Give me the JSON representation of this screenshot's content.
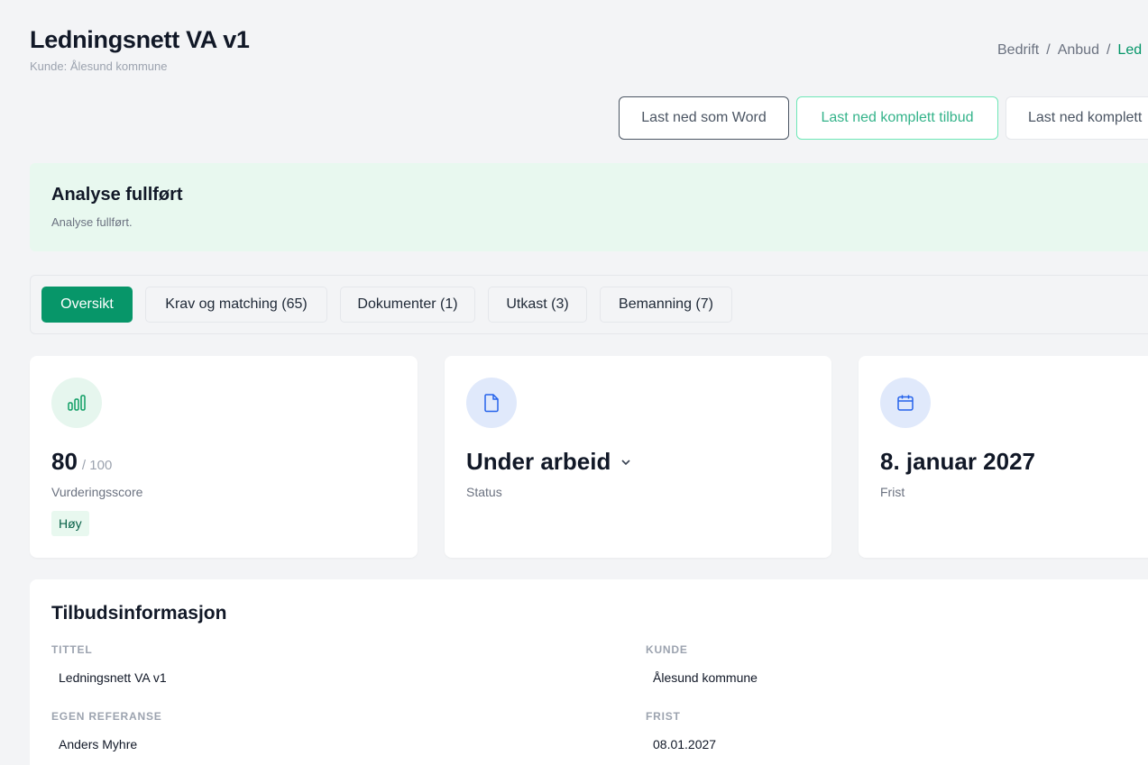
{
  "header": {
    "title": "Ledningsnett VA v1",
    "subtitle": "Kunde: Ålesund kommune"
  },
  "breadcrumb": [
    {
      "label": "Bedrift"
    },
    {
      "label": "Anbud"
    },
    {
      "label": "Led"
    }
  ],
  "breadcrumb_separator": "/",
  "actions": {
    "download_word": "Last ned som Word",
    "download_full": "Last ned komplett tilbud",
    "download_full_2": "Last ned komplett"
  },
  "alert": {
    "title": "Analyse fullført",
    "text": "Analyse fullført."
  },
  "tabs": [
    {
      "label": "Oversikt",
      "active": true
    },
    {
      "label": "Krav og matching (65)",
      "active": false
    },
    {
      "label": "Dokumenter (1)",
      "active": false
    },
    {
      "label": "Utkast (3)",
      "active": false
    },
    {
      "label": "Bemanning (7)",
      "active": false
    }
  ],
  "cards": {
    "score": {
      "icon": "bar-chart-icon",
      "value": "80",
      "denominator": "/ 100",
      "label": "Vurderingsscore",
      "badge": "Høy"
    },
    "status": {
      "icon": "document-icon",
      "value": "Under arbeid",
      "label": "Status"
    },
    "deadline": {
      "icon": "calendar-icon",
      "value": "8. januar 2027",
      "label": "Frist"
    }
  },
  "info": {
    "title": "Tilbudsinformasjon",
    "fields": {
      "title_label": "TITTEL",
      "title_value": "Ledningsnett VA v1",
      "customer_label": "KUNDE",
      "customer_value": "Ålesund kommune",
      "reference_label": "EGEN REFERANSE",
      "reference_value": "Anders Myhre",
      "deadline_label": "FRIST",
      "deadline_value": "08.01.2027"
    }
  },
  "colors": {
    "accent": "#079669",
    "alert_bg": "#e8f8ef",
    "icon_green_bg": "#e6f6ee",
    "icon_blue_bg": "#e0e9fb"
  }
}
